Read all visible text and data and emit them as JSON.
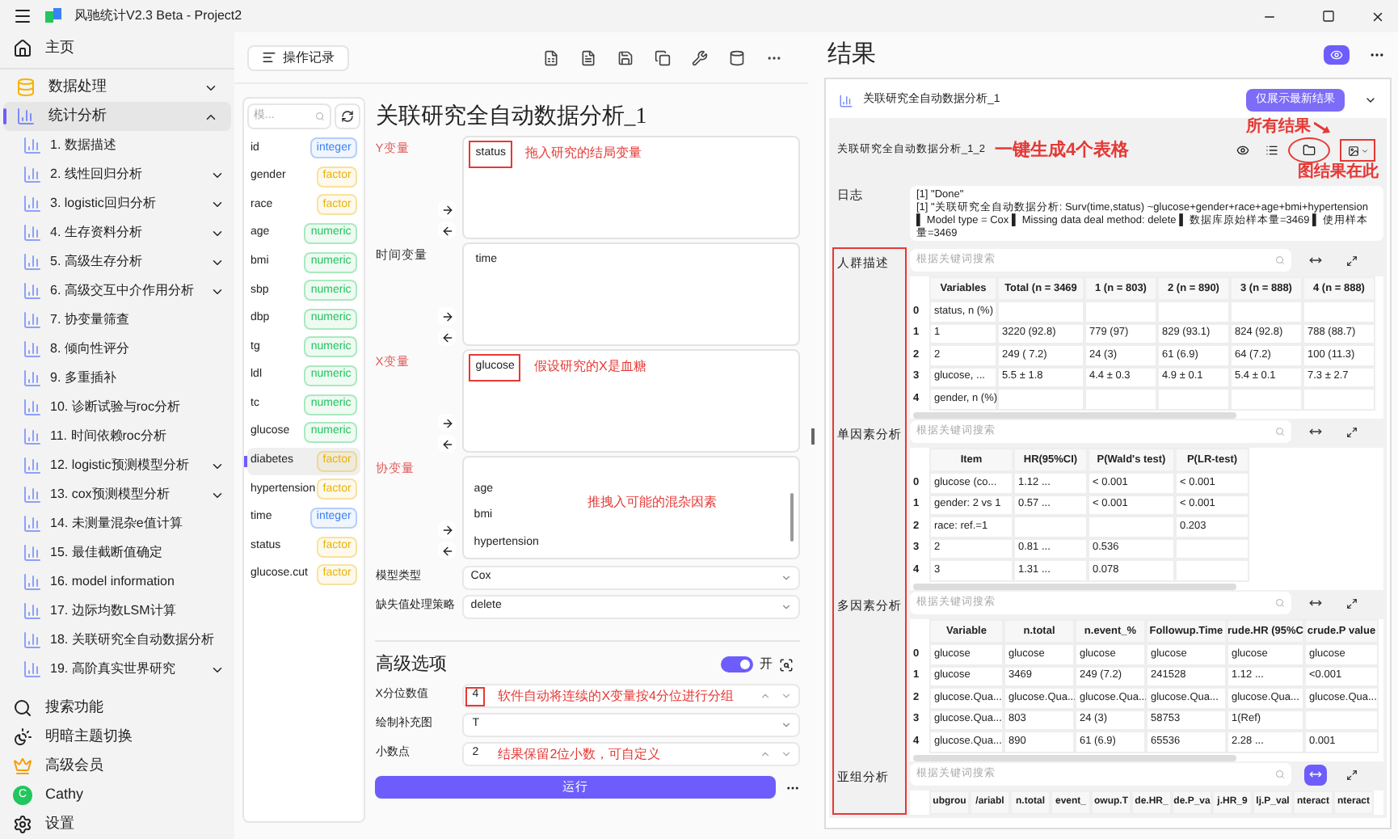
{
  "app": {
    "title": "风驰统计V2.3 Beta - Project2"
  },
  "sidebar": {
    "home": "主页",
    "items": [
      {
        "label": "数据处理",
        "expanded": false,
        "selected": false
      },
      {
        "label": "统计分析",
        "expanded": true,
        "selected": true,
        "children": [
          {
            "label": "1. 数据描述",
            "kind": "leaf"
          },
          {
            "label": "2. 线性回归分析",
            "kind": "group"
          },
          {
            "label": "3. logistic回归分析",
            "kind": "group"
          },
          {
            "label": "4. 生存资料分析",
            "kind": "group"
          },
          {
            "label": "5. 高级生存分析",
            "kind": "group"
          },
          {
            "label": "6. 高级交互中介作用分析",
            "kind": "group"
          },
          {
            "label": "7. 协变量筛查",
            "kind": "leaf"
          },
          {
            "label": "8. 倾向性评分",
            "kind": "leaf"
          },
          {
            "label": "9. 多重插补",
            "kind": "leaf"
          },
          {
            "label": "10. 诊断试验与roc分析",
            "kind": "leaf"
          },
          {
            "label": "11. 时间依赖roc分析",
            "kind": "leaf"
          },
          {
            "label": "12. logistic预测模型分析",
            "kind": "group"
          },
          {
            "label": "13. cox预测模型分析",
            "kind": "group"
          },
          {
            "label": "14. 未测量混杂e值计算",
            "kind": "leaf"
          },
          {
            "label": "15. 最佳截断值确定",
            "kind": "leaf"
          },
          {
            "label": "16. model information",
            "kind": "leaf"
          },
          {
            "label": "17. 边际均数LSM计算",
            "kind": "leaf"
          },
          {
            "label": "18. 关联研究全自动数据分析",
            "kind": "leaf"
          },
          {
            "label": "19. 高阶真实世界研究",
            "kind": "group"
          }
        ]
      }
    ],
    "bottom": [
      {
        "label": "搜索功能"
      },
      {
        "label": "明暗主题切换"
      },
      {
        "label": "高级会员"
      },
      {
        "label": "Cathy",
        "avatar_letter": "C"
      },
      {
        "label": "设置"
      }
    ]
  },
  "toolbar": {
    "history_button": "操作记录"
  },
  "variables": {
    "search_placeholder": "模...",
    "items": [
      {
        "name": "id",
        "type": "integer",
        "color": "#3b82f6",
        "selected": false
      },
      {
        "name": "gender",
        "type": "factor",
        "color": "#eab308",
        "selected": false
      },
      {
        "name": "race",
        "type": "factor",
        "color": "#eab308",
        "selected": false
      },
      {
        "name": "age",
        "type": "numeric",
        "color": "#22c55e",
        "selected": false
      },
      {
        "name": "bmi",
        "type": "numeric",
        "color": "#22c55e",
        "selected": false
      },
      {
        "name": "sbp",
        "type": "numeric",
        "color": "#22c55e",
        "selected": false
      },
      {
        "name": "dbp",
        "type": "numeric",
        "color": "#22c55e",
        "selected": false
      },
      {
        "name": "tg",
        "type": "numeric",
        "color": "#22c55e",
        "selected": false
      },
      {
        "name": "ldl",
        "type": "numeric",
        "color": "#22c55e",
        "selected": false
      },
      {
        "name": "tc",
        "type": "numeric",
        "color": "#22c55e",
        "selected": false
      },
      {
        "name": "glucose",
        "type": "numeric",
        "color": "#22c55e",
        "selected": false
      },
      {
        "name": "diabetes",
        "type": "factor",
        "color": "#eab308",
        "selected": true
      },
      {
        "name": "hypertension",
        "type": "factor",
        "color": "#eab308",
        "selected": false
      },
      {
        "name": "time",
        "type": "integer",
        "color": "#3b82f6",
        "selected": false
      },
      {
        "name": "status",
        "type": "factor",
        "color": "#eab308",
        "selected": false
      },
      {
        "name": "glucose.cut",
        "type": "factor",
        "color": "#eab308",
        "selected": false
      }
    ]
  },
  "form": {
    "title": "关联研究全自动数据分析_1",
    "drop_zones": [
      {
        "label": "Y变量",
        "required": true,
        "items": [
          {
            "name": "status",
            "highlighted": true
          }
        ],
        "note": "拖入研究的结局变量"
      },
      {
        "label": "时间变量",
        "required": false,
        "items": [
          {
            "name": "time",
            "highlighted": false
          }
        ]
      },
      {
        "label": "X变量",
        "required": true,
        "items": [
          {
            "name": "glucose",
            "highlighted": true
          }
        ],
        "note": "假设研究的X是血糖"
      },
      {
        "label": "协变量",
        "required": true,
        "items": [
          {
            "name": "age",
            "highlighted": false
          },
          {
            "name": "bmi",
            "highlighted": false
          },
          {
            "name": "hypertension",
            "highlighted": false
          }
        ],
        "note": "推拽入可能的混杂因素"
      }
    ],
    "selects": [
      {
        "label": "模型类型",
        "value": "Cox"
      },
      {
        "label": "缺失值处理策略",
        "value": "delete"
      }
    ],
    "advanced": {
      "title": "高级选项",
      "toggle_on": true,
      "toggle_label": "开",
      "fields": [
        {
          "label": "X分位数值",
          "value": "4",
          "kind": "number",
          "highlighted": true,
          "note": "软件自动将连续的X变量按4分位进行分组"
        },
        {
          "label": "绘制补充图",
          "value": "T",
          "kind": "select",
          "highlighted": false
        },
        {
          "label": "小数点",
          "value": "2",
          "kind": "number",
          "highlighted": false,
          "note": "结果保留2位小数，可自定义"
        }
      ]
    },
    "run_button": "运行"
  },
  "results": {
    "title": "结果",
    "card_title": "关联研究全自动数据分析_1",
    "latest_button": "仅展示最新结果",
    "sub_title": "关联研究全自动数据分析_1_2",
    "tables_note": "一键生成4个表格",
    "all_results_note": "所有结果",
    "figure_note": "图结果在此",
    "log_label": "日志",
    "log_lines": [
      "[1] \"Done\"",
      "[1] \"关联研究全自动数据分析: Surv(time,status) ~glucose+gender+race+age+bmi+hypertension ▌ Model type = Cox ▌ Missing data deal method: delete ▌ 数据库原始样本量=3469 ▌ 使用样本量=3469"
    ],
    "sections": [
      {
        "label": "人群描述",
        "search_placeholder": "根据关键词搜索",
        "swap_active": false,
        "columns": [
          "Variables",
          "Total (n = 3469",
          "1 (n = 803)",
          "2 (n = 890)",
          "3 (n = 888)",
          "4 (n = 888)"
        ],
        "rows": [
          {
            "index": "0",
            "cells": [
              "status, n (%)",
              null,
              null,
              null,
              null,
              null
            ]
          },
          {
            "index": "1",
            "cells": [
              "1",
              "3220 (92.8)",
              "779 (97)",
              "829 (93.1)",
              "824 (92.8)",
              "788 (88.7)"
            ]
          },
          {
            "index": "2",
            "cells": [
              "2",
              "249 ( 7.2)",
              "24 (3)",
              "61 (6.9)",
              "64 (7.2)",
              "100 (11.3)"
            ]
          },
          {
            "index": "3",
            "cells": [
              "glucose, ...",
              "5.5 ± 1.8",
              "4.4 ± 0.3",
              "4.9 ± 0.1",
              "5.4 ± 0.1",
              "7.3 ± 2.7"
            ]
          },
          {
            "index": "4",
            "cells": [
              "gender, n (%)",
              null,
              null,
              null,
              null,
              null
            ]
          }
        ]
      },
      {
        "label": "单因素分析",
        "search_placeholder": "根据关键词搜索",
        "swap_active": false,
        "columns": [
          "Item",
          "HR(95%CI)",
          "P(Wald's test)",
          "P(LR-test)"
        ],
        "rows": [
          {
            "index": "0",
            "cells": [
              "glucose (co...",
              "1.12 ...",
              "< 0.001",
              "< 0.001"
            ]
          },
          {
            "index": "1",
            "cells": [
              "gender: 2 vs 1",
              "0.57 ...",
              "< 0.001",
              "< 0.001"
            ]
          },
          {
            "index": "2",
            "cells": [
              "race: ref.=1",
              null,
              null,
              "0.203"
            ]
          },
          {
            "index": "3",
            "cells": [
              "2",
              "0.81 ...",
              "0.536",
              null
            ]
          },
          {
            "index": "4",
            "cells": [
              "3",
              "1.31 ...",
              "0.078",
              null
            ]
          }
        ]
      },
      {
        "label": "多因素分析",
        "search_placeholder": "根据关键词搜索",
        "swap_active": false,
        "columns": [
          "Variable",
          "n.total",
          "n.event_%",
          "Followup.Time",
          "rude.HR (95%C",
          "crude.P value"
        ],
        "rows": [
          {
            "index": "0",
            "cells": [
              "glucose",
              "glucose",
              "glucose",
              "glucose",
              "glucose",
              "glucose"
            ]
          },
          {
            "index": "1",
            "cells": [
              "glucose",
              "3469",
              "249 (7.2)",
              "241528",
              "1.12 ...",
              "<0.001"
            ]
          },
          {
            "index": "2",
            "cells": [
              "glucose.Qua...",
              "glucose.Qua...",
              "glucose.Qua...",
              "glucose.Qua...",
              "glucose.Qua...",
              "glucose.Qua..."
            ]
          },
          {
            "index": "3",
            "cells": [
              "glucose.Qua...",
              "803",
              "24 (3)",
              "58753",
              "1(Ref)",
              null
            ]
          },
          {
            "index": "4",
            "cells": [
              "glucose.Qua...",
              "890",
              "61 (6.9)",
              "65536",
              "2.28 ...",
              "0.001"
            ]
          }
        ]
      },
      {
        "label": "亚组分析",
        "search_placeholder": "根据关键词搜索",
        "swap_active": true,
        "columns": [
          "ubgrou",
          "/ariabl",
          "n.total",
          "event_",
          "owup.T",
          "de.HR_",
          "de.P_va",
          "j.HR_9",
          "lj.P_val",
          "nteract",
          "nteract"
        ]
      }
    ]
  }
}
